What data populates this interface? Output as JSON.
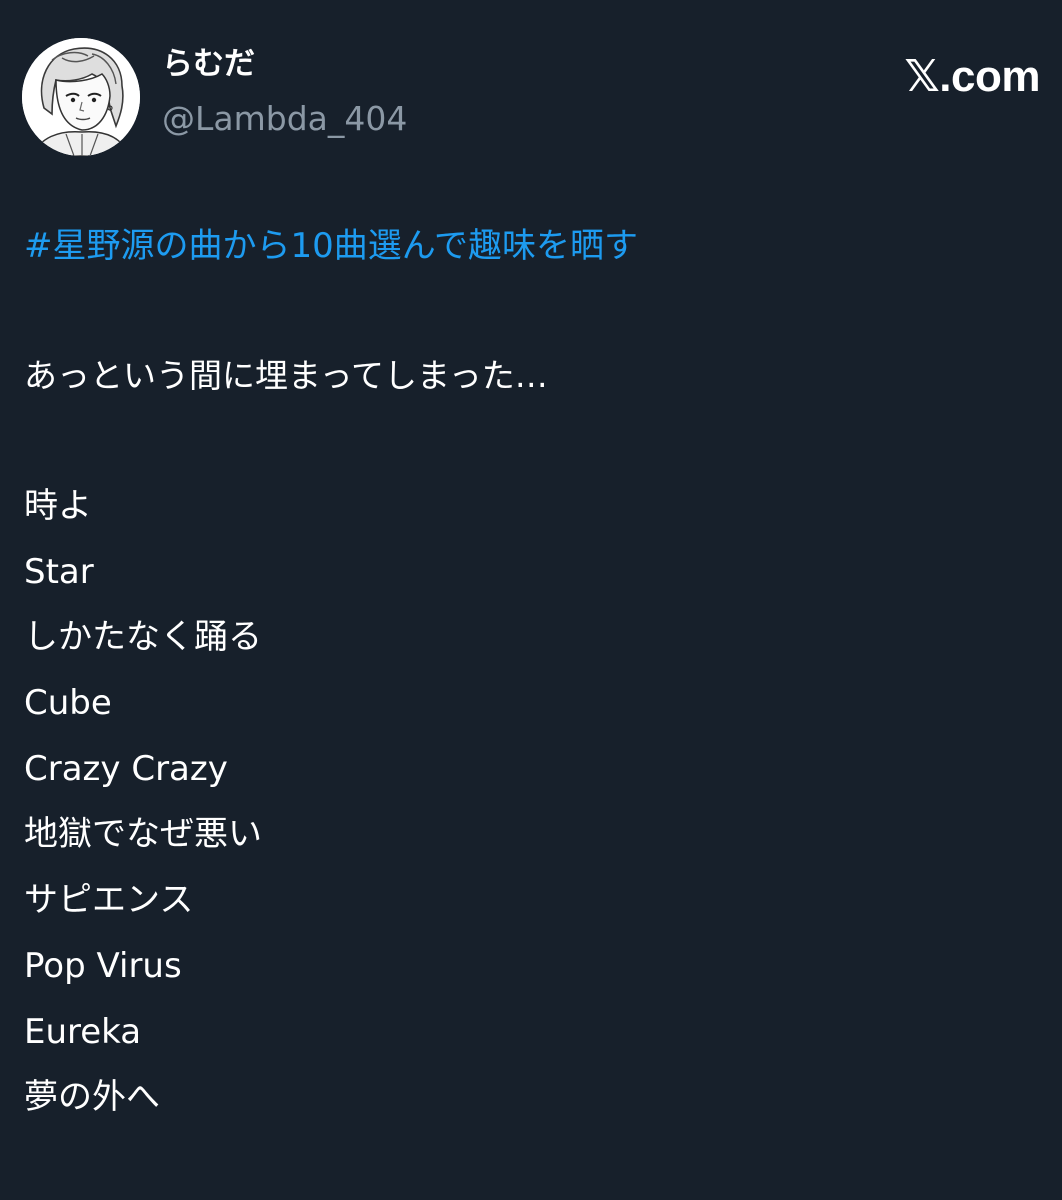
{
  "author": {
    "display_name": "らむだ",
    "handle": "@Lambda_404"
  },
  "site": {
    "logo_text": "𝕏.com"
  },
  "post": {
    "hashtag": "#星野源の曲から10曲選んで趣味を晒す",
    "caption": "あっという間に埋まってしまった…",
    "songs": [
      "時よ",
      "Star",
      "しかたなく踊る",
      "Cube",
      "Crazy Crazy",
      "地獄でなぜ悪い",
      "サピエンス",
      "Pop Virus",
      "Eureka",
      "夢の外へ"
    ]
  },
  "colors": {
    "background": "#17202b",
    "text": "#ffffff",
    "secondary_text": "#8b98a5",
    "link": "#1d9bf0"
  }
}
